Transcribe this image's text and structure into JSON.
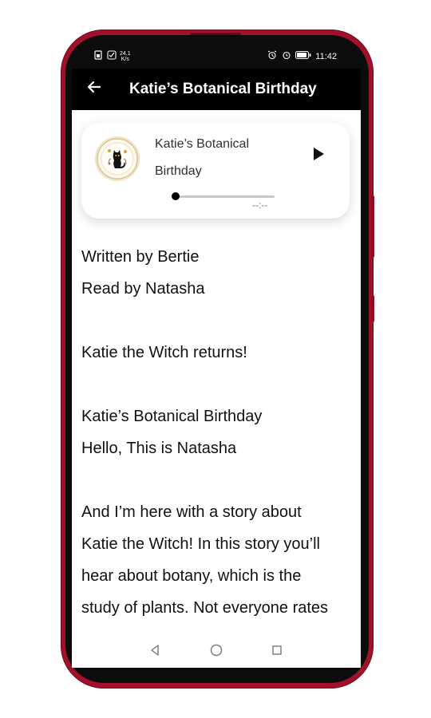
{
  "status_bar": {
    "speed_value": "24.1",
    "speed_unit": "K/s",
    "time": "11:42",
    "icons": [
      "sim-icon",
      "alarm-icon",
      "battery-icon"
    ]
  },
  "app_bar": {
    "back_icon": "arrow-left-icon",
    "title": "Katie’s Botanical Birthday"
  },
  "player": {
    "cover_icon": "witch-cat-illustration",
    "title_line_1": "Katie’s Botanical",
    "title_line_2": "Birthday",
    "play_icon": "play-icon",
    "progress": 0.0,
    "time_remaining": "--:--"
  },
  "story": {
    "lines": [
      "Written by Bertie",
      "Read by Natasha",
      "",
      "Katie the Witch returns!",
      "",
      "Katie’s Botanical Birthday",
      "Hello, This is Natasha",
      "",
      "And I’m here with a story about",
      "Katie the Witch! In this story you’ll",
      "hear about botany, which is the",
      "study of plants. Not everyone rates"
    ]
  },
  "nav_bar": {
    "back_icon": "triangle-back-icon",
    "home_icon": "circle-home-icon",
    "recents_icon": "square-recents-icon"
  },
  "colors": {
    "frame": "#a3102a",
    "app_bar": "#000000",
    "text": "#111111"
  }
}
